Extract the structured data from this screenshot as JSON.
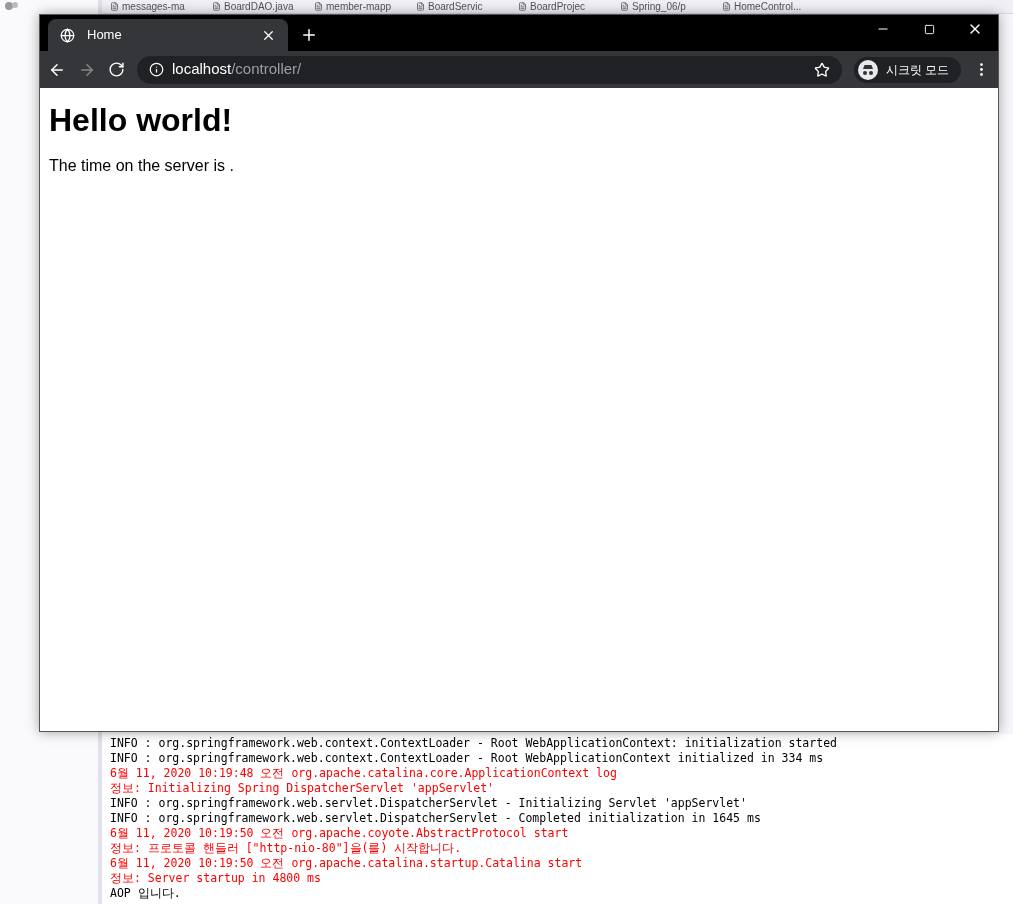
{
  "ide_tabs": [
    "messages-ma",
    "BoardDAO.java",
    "member-mapp",
    "BoardServic",
    "BoardProjec",
    "Spring_06/p",
    "HomeControl..."
  ],
  "browser": {
    "tab": {
      "title": "Home",
      "selected": true
    },
    "address": {
      "host": "localhost",
      "path": "/controller/"
    },
    "incognito_label": "시크릿 모드",
    "page": {
      "heading": "Hello world!",
      "text": "The time on the server is ."
    }
  },
  "console": [
    {
      "kind": "stdout",
      "text": "INFO : org.springframework.web.context.ContextLoader - Root WebApplicationContext: initialization started"
    },
    {
      "kind": "stdout",
      "text": "INFO : org.springframework.web.context.ContextLoader - Root WebApplicationContext initialized in 334 ms"
    },
    {
      "kind": "stderr",
      "text": "6월 11, 2020 10:19:48 오전 org.apache.catalina.core.ApplicationContext log"
    },
    {
      "kind": "stderr",
      "text": "정보: Initializing Spring DispatcherServlet 'appServlet'"
    },
    {
      "kind": "stdout",
      "text": "INFO : org.springframework.web.servlet.DispatcherServlet - Initializing Servlet 'appServlet'"
    },
    {
      "kind": "stdout",
      "text": "INFO : org.springframework.web.servlet.DispatcherServlet - Completed initialization in 1645 ms"
    },
    {
      "kind": "stderr",
      "text": "6월 11, 2020 10:19:50 오전 org.apache.coyote.AbstractProtocol start"
    },
    {
      "kind": "stderr",
      "text": "정보: 프로토콜 핸들러 [\"http-nio-80\"]을(를) 시작합니다."
    },
    {
      "kind": "stderr",
      "text": "6월 11, 2020 10:19:50 오전 org.apache.catalina.startup.Catalina start"
    },
    {
      "kind": "stderr",
      "text": "정보: Server startup in 4800 ms"
    },
    {
      "kind": "stdout",
      "text": "AOP 입니다."
    }
  ]
}
